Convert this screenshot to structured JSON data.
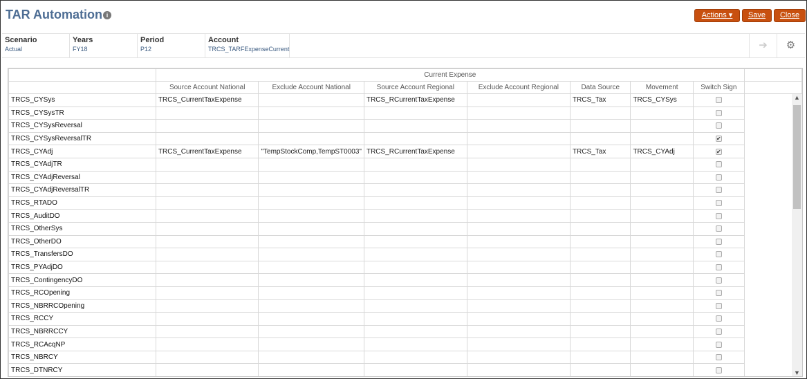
{
  "header": {
    "title": "TAR Automation",
    "info_icon": "i",
    "actions": "Actions ▾",
    "save": "Save",
    "close": "Close"
  },
  "pov": [
    {
      "label": "Scenario",
      "value": "Actual"
    },
    {
      "label": "Years",
      "value": "FY18"
    },
    {
      "label": "Period",
      "value": "P12"
    },
    {
      "label": "Account",
      "value": "TRCS_TARFExpenseCurrent"
    }
  ],
  "grid": {
    "group_header": "Current Expense",
    "columns": [
      "Source Account National",
      "Exclude Account National",
      "Source Account Regional",
      "Exclude Account Regional",
      "Data Source",
      "Movement",
      "Switch Sign"
    ],
    "rows": [
      {
        "name": "TRCS_CYSys",
        "cells": [
          "TRCS_CurrentTaxExpense",
          "",
          "TRCS_RCurrentTaxExpense",
          "",
          "TRCS_Tax",
          "TRCS_CYSys"
        ],
        "switch": false
      },
      {
        "name": "TRCS_CYSysTR",
        "cells": [
          "",
          "",
          "",
          "",
          "",
          ""
        ],
        "switch": false
      },
      {
        "name": "TRCS_CYSysReversal",
        "cells": [
          "",
          "",
          "",
          "",
          "",
          ""
        ],
        "switch": false
      },
      {
        "name": "TRCS_CYSysReversalTR",
        "cells": [
          "",
          "",
          "",
          "",
          "",
          ""
        ],
        "switch": true
      },
      {
        "name": "TRCS_CYAdj",
        "cells": [
          "TRCS_CurrentTaxExpense",
          "\"TempStockComp,TempST0003\"",
          "TRCS_RCurrentTaxExpense",
          "",
          "TRCS_Tax",
          "TRCS_CYAdj"
        ],
        "switch": true
      },
      {
        "name": "TRCS_CYAdjTR",
        "cells": [
          "",
          "",
          "",
          "",
          "",
          ""
        ],
        "switch": false
      },
      {
        "name": "TRCS_CYAdjReversal",
        "cells": [
          "",
          "",
          "",
          "",
          "",
          ""
        ],
        "switch": false
      },
      {
        "name": "TRCS_CYAdjReversalTR",
        "cells": [
          "",
          "",
          "",
          "",
          "",
          ""
        ],
        "switch": false
      },
      {
        "name": "TRCS_RTADO",
        "cells": [
          "",
          "",
          "",
          "",
          "",
          ""
        ],
        "switch": false
      },
      {
        "name": "TRCS_AuditDO",
        "cells": [
          "",
          "",
          "",
          "",
          "",
          ""
        ],
        "switch": false
      },
      {
        "name": "TRCS_OtherSys",
        "cells": [
          "",
          "",
          "",
          "",
          "",
          ""
        ],
        "switch": false
      },
      {
        "name": "TRCS_OtherDO",
        "cells": [
          "",
          "",
          "",
          "",
          "",
          ""
        ],
        "switch": false
      },
      {
        "name": "TRCS_TransfersDO",
        "cells": [
          "",
          "",
          "",
          "",
          "",
          ""
        ],
        "switch": false
      },
      {
        "name": "TRCS_PYAdjDO",
        "cells": [
          "",
          "",
          "",
          "",
          "",
          ""
        ],
        "switch": false
      },
      {
        "name": "TRCS_ContingencyDO",
        "cells": [
          "",
          "",
          "",
          "",
          "",
          ""
        ],
        "switch": false
      },
      {
        "name": "TRCS_RCOpening",
        "cells": [
          "",
          "",
          "",
          "",
          "",
          ""
        ],
        "switch": false
      },
      {
        "name": "TRCS_NBRRCOpening",
        "cells": [
          "",
          "",
          "",
          "",
          "",
          ""
        ],
        "switch": false
      },
      {
        "name": "TRCS_RCCY",
        "cells": [
          "",
          "",
          "",
          "",
          "",
          ""
        ],
        "switch": false
      },
      {
        "name": "TRCS_NBRRCCY",
        "cells": [
          "",
          "",
          "",
          "",
          "",
          ""
        ],
        "switch": false
      },
      {
        "name": "TRCS_RCAcqNP",
        "cells": [
          "",
          "",
          "",
          "",
          "",
          ""
        ],
        "switch": false
      },
      {
        "name": "TRCS_NBRCY",
        "cells": [
          "",
          "",
          "",
          "",
          "",
          ""
        ],
        "switch": false
      },
      {
        "name": "TRCS_DTNRCY",
        "cells": [
          "",
          "",
          "",
          "",
          "",
          ""
        ],
        "switch": false
      }
    ]
  }
}
